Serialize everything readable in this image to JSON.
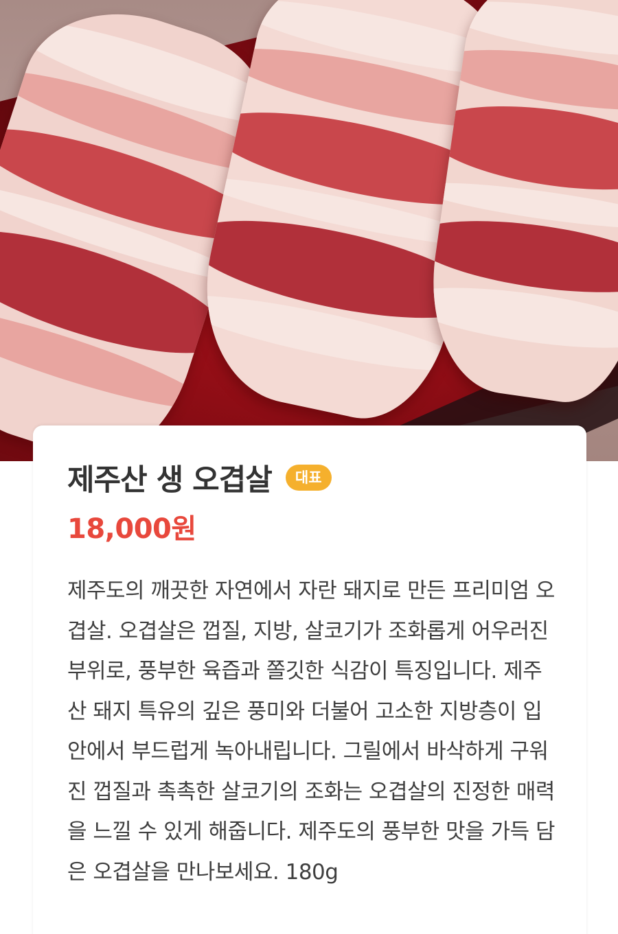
{
  "product": {
    "name": "제주산 생 오겹살",
    "badge": "대표",
    "price": "18,000원",
    "description": "제주도의 깨끗한 자연에서 자란 돼지로 만든 프리미엄 오겹살. 오겹살은 껍질, 지방, 살코기가 조화롭게 어우러진 부위로, 풍부한 육즙과 쫄깃한 식감이 특징입니다. 제주산 돼지 특유의 깊은 풍미와 더불어 고소한 지방층이 입안에서 부드럽게 녹아내립니다. 그릴에서 바삭하게 구워진 껍질과 촉촉한 살코기의 조화는 오겹살의 진정한 매력을 느낄 수 있게 해줍니다. 제주도의 풍부한 맛을 가득 담은 오겹살을 만나보세요. 180g"
  },
  "colors": {
    "badge": "#f5b02d",
    "price": "#e8483c",
    "title": "#333333",
    "body_text": "#3f3f3f"
  }
}
